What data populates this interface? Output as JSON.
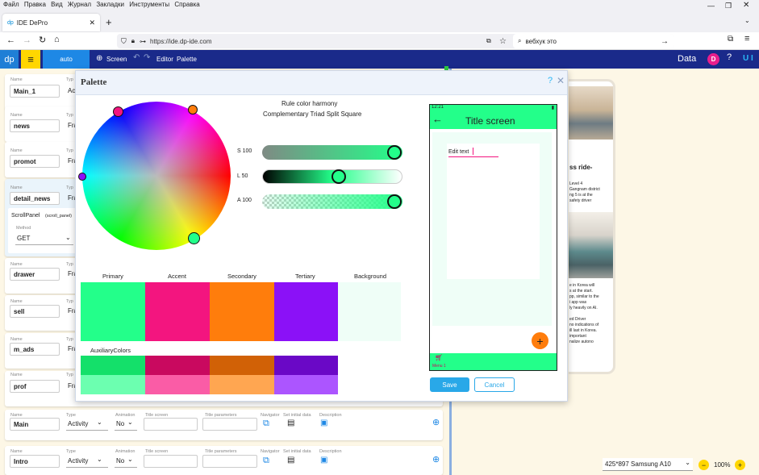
{
  "browser": {
    "menu": [
      "Файл",
      "Правка",
      "Вид",
      "Журнал",
      "Закладки",
      "Инструменты",
      "Справка"
    ],
    "tab_title": "IDE DePro",
    "url": "https://ide.dp-ide.com",
    "search_text": "вебхук это"
  },
  "appbar": {
    "logo": "dp",
    "mode": "auto",
    "screen_label": "Screen",
    "editor_label": "Editor",
    "palette_label": "Palette",
    "data_label": "Data",
    "avatar_letter": "D",
    "ui_label": "U I"
  },
  "screens": [
    {
      "name_label": "Name",
      "name": "Main_1",
      "type_label": "Typ",
      "type": "Act"
    },
    {
      "name_label": "Name",
      "name": "news",
      "type_label": "Typ",
      "type": "Fra"
    },
    {
      "name_label": "Name",
      "name": "promot",
      "type_label": "Typ",
      "type": "Fra"
    },
    {
      "name_label": "Name",
      "name": "detail_news",
      "type_label": "Typ",
      "type": "Fra"
    }
  ],
  "scroll_panel": {
    "title": "ScrollPanel",
    "sub": "(scroll_panel)",
    "method_label": "Method",
    "method": "GET"
  },
  "screens2": [
    {
      "name_label": "Name",
      "name": "drawer",
      "type_label": "Typ",
      "type": "Fra"
    },
    {
      "name_label": "Name",
      "name": "sell",
      "type_label": "Typ",
      "type": "Fra"
    },
    {
      "name_label": "Name",
      "name": "m_ads",
      "type_label": "Typ",
      "type": "Fra"
    },
    {
      "name_label": "Name",
      "name": "prof",
      "type_label": "Typ",
      "type": "Fra"
    }
  ],
  "full_rows": [
    {
      "name": "Main",
      "type": "Activity",
      "anim": "No"
    },
    {
      "name": "Intro",
      "type": "Activity",
      "anim": "No"
    }
  ],
  "row_labels": {
    "name": "Name",
    "type": "Type",
    "animation": "Animation",
    "title_screen": "Title screen",
    "title_params": "Title parameters",
    "navigator": "Navigator",
    "set_initial": "Set initial data",
    "description": "Description"
  },
  "palette": {
    "title": "Palette",
    "rule_title": "Rule color harmony",
    "rules": [
      "Complementary",
      "Triad",
      "Split",
      "Square"
    ],
    "s_label": "S 100",
    "s_value": 100,
    "l_label": "L 50",
    "l_value": 50,
    "a_label": "A 100",
    "a_value": 100,
    "main_names": [
      "Primary",
      "Accent",
      "Secondary",
      "Tertiary",
      "Background"
    ],
    "main_colors": [
      "#23ff8a",
      "#f3157f",
      "#ff7d0c",
      "#8b11f7",
      "#effef7"
    ],
    "aux_title": "AuxiliaryColors",
    "aux_dark": [
      "#14e06a",
      "#c9095f",
      "#d16106",
      "#6a08c6"
    ],
    "aux_light": [
      "#6cffb0",
      "#fa5ca6",
      "#ffa651",
      "#ac55ff"
    ]
  },
  "preview": {
    "time": "12:21",
    "title": "Title screen",
    "edit_text": "Edit text",
    "menu_label": "Menu 1",
    "save_label": "Save",
    "cancel_label": "Cancel"
  },
  "device_text": {
    "heading": "ss ride-",
    "p1": [
      "Level 4",
      "Gangnam district",
      "ng 5 is at the",
      "safety driver"
    ],
    "p2": [
      "e in Korea will",
      "s at the start.",
      "pp, similar to the",
      "i app was",
      "ly heavily on AI."
    ],
    "p3": [
      "ed Driver",
      "no indications of",
      "ill last in Korea.",
      "important",
      "nalize autono"
    ]
  },
  "footer": {
    "device": "425*897 Samsung A10",
    "zoom": "100%"
  }
}
